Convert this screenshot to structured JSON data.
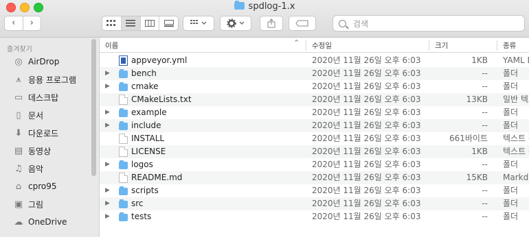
{
  "window": {
    "title": "spdlog-1.x"
  },
  "toolbar": {
    "back": "‹",
    "forward": "›",
    "search_placeholder": "검색"
  },
  "sidebar": {
    "header": "즐겨찾기",
    "items": [
      {
        "label": "AirDrop",
        "icon": "airdrop-icon"
      },
      {
        "label": "응용 프로그램",
        "icon": "applications-icon"
      },
      {
        "label": "데스크탑",
        "icon": "desktop-icon"
      },
      {
        "label": "문서",
        "icon": "documents-icon"
      },
      {
        "label": "다운로드",
        "icon": "downloads-icon"
      },
      {
        "label": "동영상",
        "icon": "movies-icon"
      },
      {
        "label": "음악",
        "icon": "music-icon"
      },
      {
        "label": "cpro95",
        "icon": "home-icon"
      },
      {
        "label": "그림",
        "icon": "pictures-icon"
      },
      {
        "label": "OneDrive",
        "icon": "cloud-icon"
      }
    ]
  },
  "columns": {
    "name": "이름",
    "date": "수정일",
    "size": "크기",
    "kind": "종류"
  },
  "files": [
    {
      "name": "appveyor.yml",
      "type": "yml",
      "date": "2020년 11월 26일 오후 6:03",
      "size": "1KB",
      "kind": "YAML D"
    },
    {
      "name": "bench",
      "type": "folder",
      "date": "2020년 11월 26일 오후 6:03",
      "size": "--",
      "kind": "폴더"
    },
    {
      "name": "cmake",
      "type": "folder",
      "date": "2020년 11월 26일 오후 6:03",
      "size": "--",
      "kind": "폴더"
    },
    {
      "name": "CMakeLists.txt",
      "type": "doc",
      "date": "2020년 11월 26일 오후 6:03",
      "size": "13KB",
      "kind": "일반 텍스"
    },
    {
      "name": "example",
      "type": "folder",
      "date": "2020년 11월 26일 오후 6:03",
      "size": "--",
      "kind": "폴더"
    },
    {
      "name": "include",
      "type": "folder",
      "date": "2020년 11월 26일 오후 6:03",
      "size": "--",
      "kind": "폴더"
    },
    {
      "name": "INSTALL",
      "type": "doc",
      "date": "2020년 11월 26일 오후 6:03",
      "size": "661바이트",
      "kind": "텍스트 편"
    },
    {
      "name": "LICENSE",
      "type": "doc",
      "date": "2020년 11월 26일 오후 6:03",
      "size": "1KB",
      "kind": "텍스트 편"
    },
    {
      "name": "logos",
      "type": "folder",
      "date": "2020년 11월 26일 오후 6:03",
      "size": "--",
      "kind": "폴더"
    },
    {
      "name": "README.md",
      "type": "doc",
      "date": "2020년 11월 26일 오후 6:03",
      "size": "15KB",
      "kind": "Markdo"
    },
    {
      "name": "scripts",
      "type": "folder",
      "date": "2020년 11월 26일 오후 6:03",
      "size": "--",
      "kind": "폴더"
    },
    {
      "name": "src",
      "type": "folder",
      "date": "2020년 11월 26일 오후 6:03",
      "size": "--",
      "kind": "폴더"
    },
    {
      "name": "tests",
      "type": "folder",
      "date": "2020년 11월 26일 오후 6:03",
      "size": "--",
      "kind": "폴더"
    }
  ]
}
